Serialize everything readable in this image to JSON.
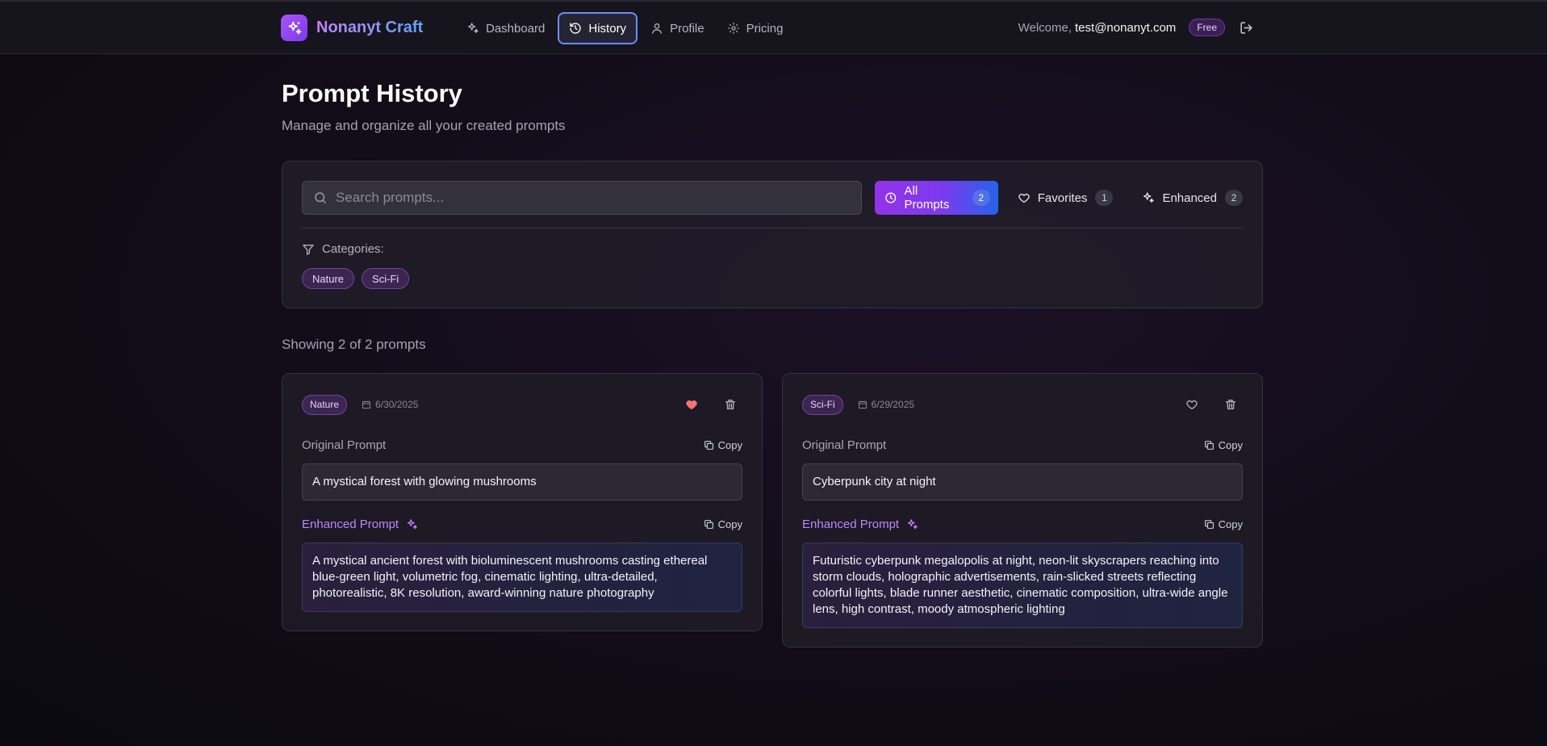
{
  "app": {
    "name": "Nonanyt Craft"
  },
  "nav": {
    "items": [
      {
        "label": "Dashboard",
        "icon": "sparkles-icon"
      },
      {
        "label": "History",
        "icon": "history-icon"
      },
      {
        "label": "Profile",
        "icon": "user-icon"
      },
      {
        "label": "Pricing",
        "icon": "gear-icon"
      }
    ],
    "active": "History"
  },
  "user": {
    "welcome": "Welcome,",
    "email": "test@nonanyt.com",
    "plan": "Free"
  },
  "page": {
    "title": "Prompt History",
    "subtitle": "Manage and organize all your created prompts"
  },
  "search": {
    "placeholder": "Search prompts...",
    "value": ""
  },
  "filters": [
    {
      "label": "All Prompts",
      "count": "2",
      "icon": "clock-icon",
      "active": true
    },
    {
      "label": "Favorites",
      "count": "1",
      "icon": "heart-icon",
      "active": false
    },
    {
      "label": "Enhanced",
      "count": "2",
      "icon": "sparkles-icon",
      "active": false
    }
  ],
  "categories": {
    "label": "Categories:",
    "items": [
      "Nature",
      "Sci-Fi"
    ]
  },
  "results": {
    "summary": "Showing 2 of 2 prompts"
  },
  "labels": {
    "original": "Original Prompt",
    "enhanced": "Enhanced Prompt",
    "copy": "Copy"
  },
  "prompts": [
    {
      "category": "Nature",
      "date": "6/30/2025",
      "favorite": true,
      "original": "A mystical forest with glowing mushrooms",
      "enhanced": "A mystical ancient forest with bioluminescent mushrooms casting ethereal blue-green light, volumetric fog, cinematic lighting, ultra-detailed, photorealistic, 8K resolution, award-winning nature photography"
    },
    {
      "category": "Sci-Fi",
      "date": "6/29/2025",
      "favorite": false,
      "original": "Cyberpunk city at night",
      "enhanced": "Futuristic cyberpunk megalopolis at night, neon-lit skyscrapers reaching into storm clouds, holographic advertisements, rain-slicked streets reflecting colorful lights, blade runner aesthetic, cinematic composition, ultra-wide angle lens, high contrast, moody atmospheric lighting"
    }
  ],
  "colors": {
    "accent": "#9333ea",
    "accent_blue": "#2563eb",
    "favorite": "#f87171",
    "enhanced_label": "#c084fc"
  }
}
